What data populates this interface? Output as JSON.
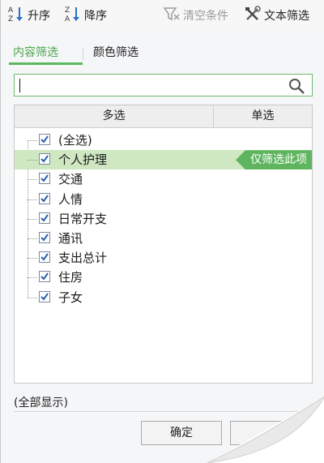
{
  "toolbar": {
    "sort_asc_label": "升序",
    "sort_desc_label": "降序",
    "clear_filter_label": "清空条件",
    "text_filter_label": "文本筛选"
  },
  "tabs": [
    {
      "label": "内容筛选",
      "active": true
    },
    {
      "label": "颜色筛选",
      "active": false
    }
  ],
  "search": {
    "value": "",
    "placeholder": ""
  },
  "list": {
    "multi_header": "多选",
    "single_header": "单选",
    "items": [
      {
        "label": "(全选)",
        "checked": true
      },
      {
        "label": "个人护理",
        "checked": true,
        "highlighted": true
      },
      {
        "label": "交通",
        "checked": true
      },
      {
        "label": "人情",
        "checked": true
      },
      {
        "label": "日常开支",
        "checked": true
      },
      {
        "label": "通讯",
        "checked": true
      },
      {
        "label": "支出总计",
        "checked": true
      },
      {
        "label": "住房",
        "checked": true
      },
      {
        "label": "子女",
        "checked": true
      }
    ],
    "only_this_label": "仅筛选此项"
  },
  "footer": {
    "show_all_label": "(全部显示)",
    "ok_label": "确定",
    "cancel_label": ""
  },
  "colors": {
    "accent_green": "#5fb55f",
    "highlight_row": "#cfe8c2",
    "check_blue": "#2a5fb0"
  }
}
